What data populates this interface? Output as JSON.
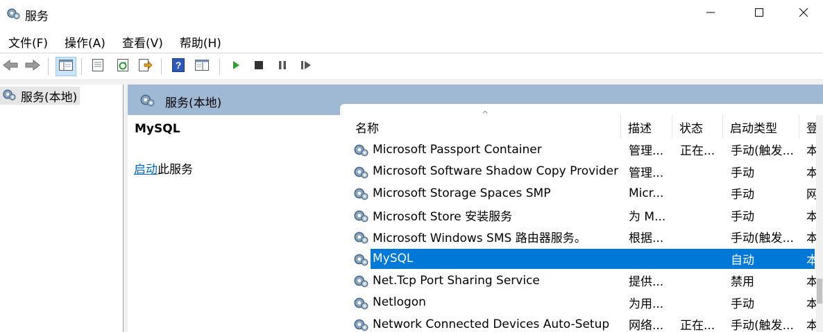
{
  "window": {
    "title": "服务"
  },
  "menu": [
    "文件(F)",
    "操作(A)",
    "查看(V)",
    "帮助(H)"
  ],
  "tree": {
    "root_label": "服务(本地)"
  },
  "content": {
    "header_title": "服务(本地)"
  },
  "description": {
    "service_name": "MySQL",
    "action_link": "启动",
    "action_suffix": "此服务"
  },
  "table": {
    "columns": [
      "名称",
      "描述",
      "状态",
      "启动类型",
      "登"
    ],
    "rows": [
      {
        "name": "Microsoft Passport Container",
        "desc": "管理...",
        "status": "正在...",
        "startup": "手动(触发...",
        "logon": "本"
      },
      {
        "name": "Microsoft Software Shadow Copy Provider",
        "desc": "管理...",
        "status": "",
        "startup": "手动",
        "logon": "本"
      },
      {
        "name": "Microsoft Storage Spaces SMP",
        "desc": "Micr...",
        "status": "",
        "startup": "手动",
        "logon": "网"
      },
      {
        "name": "Microsoft Store 安装服务",
        "desc": "为 M...",
        "status": "",
        "startup": "手动",
        "logon": "本"
      },
      {
        "name": "Microsoft Windows SMS 路由器服务。",
        "desc": "根据...",
        "status": "",
        "startup": "手动(触发...",
        "logon": "本"
      },
      {
        "name": "MySQL",
        "desc": "",
        "status": "",
        "startup": "自动",
        "logon": "本",
        "selected": true
      },
      {
        "name": "Net.Tcp Port Sharing Service",
        "desc": "提供...",
        "status": "",
        "startup": "禁用",
        "logon": "本"
      },
      {
        "name": "Netlogon",
        "desc": "为用...",
        "status": "",
        "startup": "手动",
        "logon": "本"
      },
      {
        "name": "Network Connected Devices Auto-Setup",
        "desc": "网络...",
        "status": "正在...",
        "startup": "手动(触发...",
        "logon": "本"
      }
    ]
  },
  "colors": {
    "selection": "#0078d7",
    "header_band": "#9fb9d5",
    "link": "#0066cc"
  },
  "icons": {
    "app": "gear-icon",
    "toolbar": [
      "back-arrow-icon",
      "forward-arrow-icon",
      "show-hide-tree-icon",
      "properties-icon",
      "refresh-icon",
      "export-list-icon",
      "help-icon",
      "console-view-icon",
      "play-icon",
      "stop-icon",
      "pause-icon",
      "resume-icon"
    ]
  }
}
